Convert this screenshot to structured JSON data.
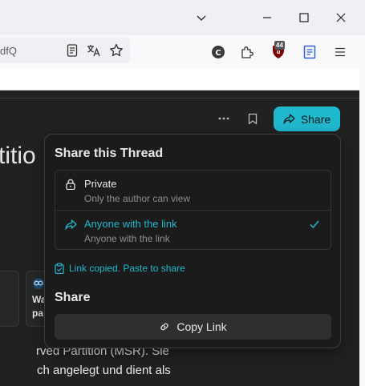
{
  "browser": {
    "url_fragment": "dfQ",
    "colors": {
      "titlebar": "#f0f0f4",
      "toolbar": "#f9f9fb"
    },
    "window_controls": [
      "chevron-down-icon",
      "minimize-icon",
      "maximize-icon",
      "close-icon"
    ],
    "extension_badge": "44",
    "toolbar_icons": [
      "reader-view-icon",
      "translate-icon",
      "bookmark-star-icon",
      "c-extension-icon",
      "extensions-puzzle-icon",
      "ublock-shield-icon",
      "notes-icon",
      "menu-icon"
    ]
  },
  "page": {
    "title_fragment": "titio",
    "header_icons": [
      "more-dots-icon",
      "bookmark-icon"
    ],
    "share_label": "Share",
    "card_text_1": "Wa",
    "card_text_2": "pa",
    "body_line_1": "rved Partition (MSR). Sie",
    "body_line_2": "ch angelegt und dient als"
  },
  "share_popover": {
    "title": "Share this Thread",
    "options": [
      {
        "icon": "lock-icon",
        "title": "Private",
        "description": "Only the author can view",
        "selected": false
      },
      {
        "icon": "share-arrow-icon",
        "title": "Anyone with the link",
        "description": "Anyone with the link",
        "selected": true
      }
    ],
    "copied_message": "Link copied. Paste to share",
    "share_heading": "Share",
    "copy_link_label": "Copy Link"
  },
  "colors": {
    "accent": "#20b8cd",
    "page_bg": "#202222",
    "popover_bg": "#1b1b1b"
  }
}
